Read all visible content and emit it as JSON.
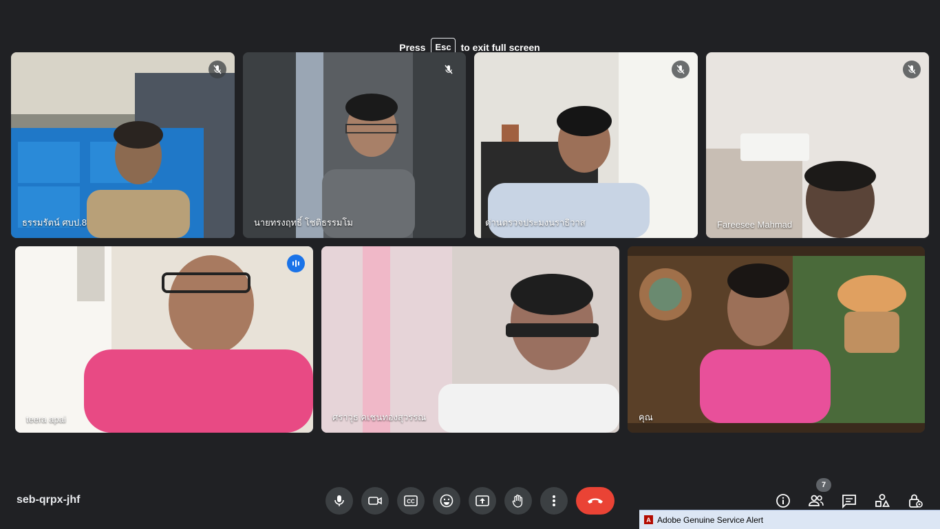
{
  "banner": {
    "press": "Press",
    "key": "Esc",
    "suffix": "to exit full screen"
  },
  "participants": [
    {
      "name": "ธรรมรัตน์ ศบป.8",
      "muted": true
    },
    {
      "name": "นายทรงฤทธิ์ โชติธรรมโม",
      "muted": true
    },
    {
      "name": "ด่านตรวจประมงนราธิวาส",
      "muted": true
    },
    {
      "name": "Fareesee Mahmad",
      "muted": true
    },
    {
      "name": "teera apai",
      "speaking": true
    },
    {
      "name": "ศราวุธ คเชนทองสุวรรณ"
    },
    {
      "name": "คุณ"
    }
  ],
  "meeting_code": "seb-qrpx-jhf",
  "controls": [
    "microphone-icon",
    "camera-icon",
    "captions-icon",
    "emoji-icon",
    "present-icon",
    "raise-hand-icon",
    "more-options-icon",
    "end-call-icon"
  ],
  "right_controls": [
    "info-icon",
    "people-icon",
    "chat-icon",
    "activities-icon",
    "host-controls-icon"
  ],
  "people_count": "7",
  "taskbar_alert": {
    "title": "Adobe Genuine Service Alert"
  },
  "colors": {
    "background": "#202124",
    "end_call": "#ea4335",
    "active_border": "#8ab4f8",
    "speaking": "#1a73e8"
  }
}
